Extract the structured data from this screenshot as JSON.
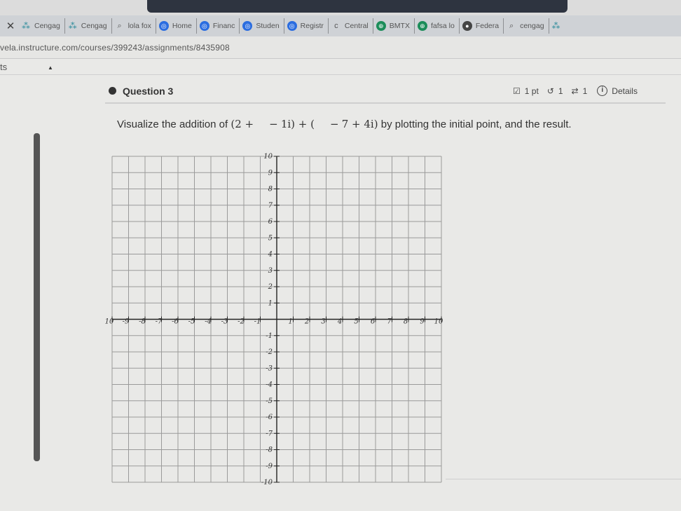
{
  "browser": {
    "tabs": [
      {
        "label": "Cengag",
        "icon": "cengage-icon"
      },
      {
        "label": "Cengag",
        "icon": "cengage-icon"
      },
      {
        "label": "lola fox",
        "icon": "search-icon"
      },
      {
        "label": "Home",
        "icon": "canvas-icon"
      },
      {
        "label": "Financ",
        "icon": "canvas-icon"
      },
      {
        "label": "Studen",
        "icon": "canvas-icon"
      },
      {
        "label": "Registr",
        "icon": "canvas-icon"
      },
      {
        "label": "Central",
        "icon": "c-icon"
      },
      {
        "label": "BMTX",
        "icon": "globe-icon"
      },
      {
        "label": "fafsa lo",
        "icon": "globe-icon"
      },
      {
        "label": "Federa",
        "icon": "federal-icon"
      },
      {
        "label": "cengag",
        "icon": "search-icon"
      }
    ],
    "url": "vela.instructure.com/courses/399243/assignments/8435908"
  },
  "breadcrumb": {
    "label": "ts"
  },
  "question": {
    "title": "Question 3",
    "points": "1 pt",
    "attempts": "1",
    "retries": "1",
    "details_label": "Details"
  },
  "prompt": {
    "before": "Visualize the addition of",
    "expr_a": "(2 +",
    "expr_b": "1i) + (",
    "expr_c": "7 + 4i)",
    "after": "by plotting the initial point, and the result."
  },
  "chart_data": {
    "type": "scatter",
    "xlim": [
      -10,
      10
    ],
    "ylim": [
      -10,
      10
    ],
    "x_ticks": [
      "10",
      "-9",
      "-8",
      "-7",
      "-6",
      "-5",
      "-4",
      "-3",
      "-2",
      "-1",
      "1",
      "2",
      "3",
      "4",
      "5",
      "6",
      "7",
      "8",
      "9",
      "10"
    ],
    "y_ticks": [
      "10",
      "9",
      "8",
      "7",
      "6",
      "5",
      "4",
      "3",
      "2",
      "1",
      "-1",
      "-2",
      "-3",
      "-4",
      "-5",
      "-6",
      "-7",
      "-8",
      "-9",
      "-10"
    ],
    "grid": true,
    "points": []
  }
}
